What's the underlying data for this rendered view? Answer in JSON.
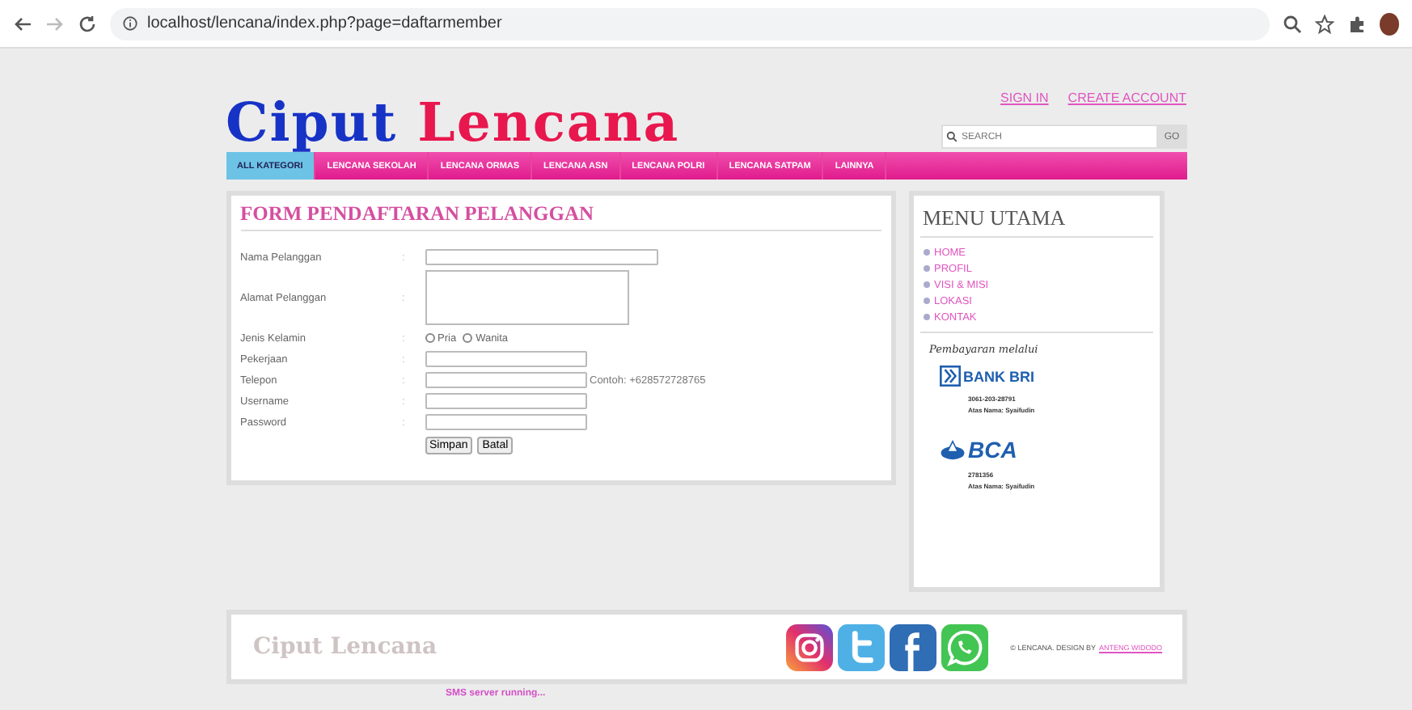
{
  "browser": {
    "url": "localhost/lencana/index.php?page=daftarmember"
  },
  "header": {
    "logo_first": "Ciput",
    "logo_second": "Lencana",
    "links": [
      "SIGN IN",
      "CREATE ACCOUNT"
    ],
    "search": {
      "placeholder": "SEARCH",
      "button": "GO"
    }
  },
  "nav": [
    {
      "label": "ALL KATEGORI",
      "selected": true
    },
    {
      "label": "LENCANA SEKOLAH",
      "selected": false
    },
    {
      "label": "LENCANA ORMAS",
      "selected": false
    },
    {
      "label": "LENCANA ASN",
      "selected": false
    },
    {
      "label": "LENCANA POLRI",
      "selected": false
    },
    {
      "label": "LENCANA SATPAM",
      "selected": false
    },
    {
      "label": "LAINNYA",
      "selected": false
    }
  ],
  "form": {
    "title": "FORM PENDAFTARAN PELANGGAN",
    "fields": [
      {
        "kind": "text",
        "label": "Nama Pelanggan",
        "separator": ":",
        "wide": true
      },
      {
        "kind": "textarea",
        "label": "Alamat Pelanggan",
        "separator": ":"
      },
      {
        "kind": "radio",
        "label": "Jenis Kelamin",
        "separator": ":",
        "options": [
          {
            "label": "Pria",
            "selected": false
          },
          {
            "label": "Wanita",
            "selected": false
          }
        ]
      },
      {
        "kind": "text",
        "label": "Pekerjaan",
        "separator": ":"
      },
      {
        "kind": "text",
        "label": "Telepon",
        "separator": ":",
        "hint": "Contoh: +628572728765"
      },
      {
        "kind": "text",
        "label": "Username",
        "separator": ":"
      },
      {
        "kind": "text",
        "label": "Password",
        "separator": ":"
      }
    ],
    "buttons": [
      "Simpan",
      "Batal"
    ]
  },
  "sidebar": {
    "title": "MENU UTAMA",
    "items": [
      "HOME",
      "PROFIL",
      "VISI & MISI",
      "LOKASI",
      "KONTAK"
    ],
    "payment_title": "Pembayaran melalui",
    "banks": [
      {
        "kind": "bri",
        "name": "BANK BRI",
        "account": "3061-203-28791",
        "holder": "Atas Nama: Syaifudin"
      },
      {
        "kind": "bca",
        "name": "BCA",
        "account": "2781356",
        "holder": "Atas Nama: Syaifudin"
      }
    ]
  },
  "footer": {
    "logo": "Ciput Lencana",
    "copyright": "© LENCANA. DESIGN BY",
    "author": "ANTENG WIDODO"
  },
  "status": "SMS server running..."
}
